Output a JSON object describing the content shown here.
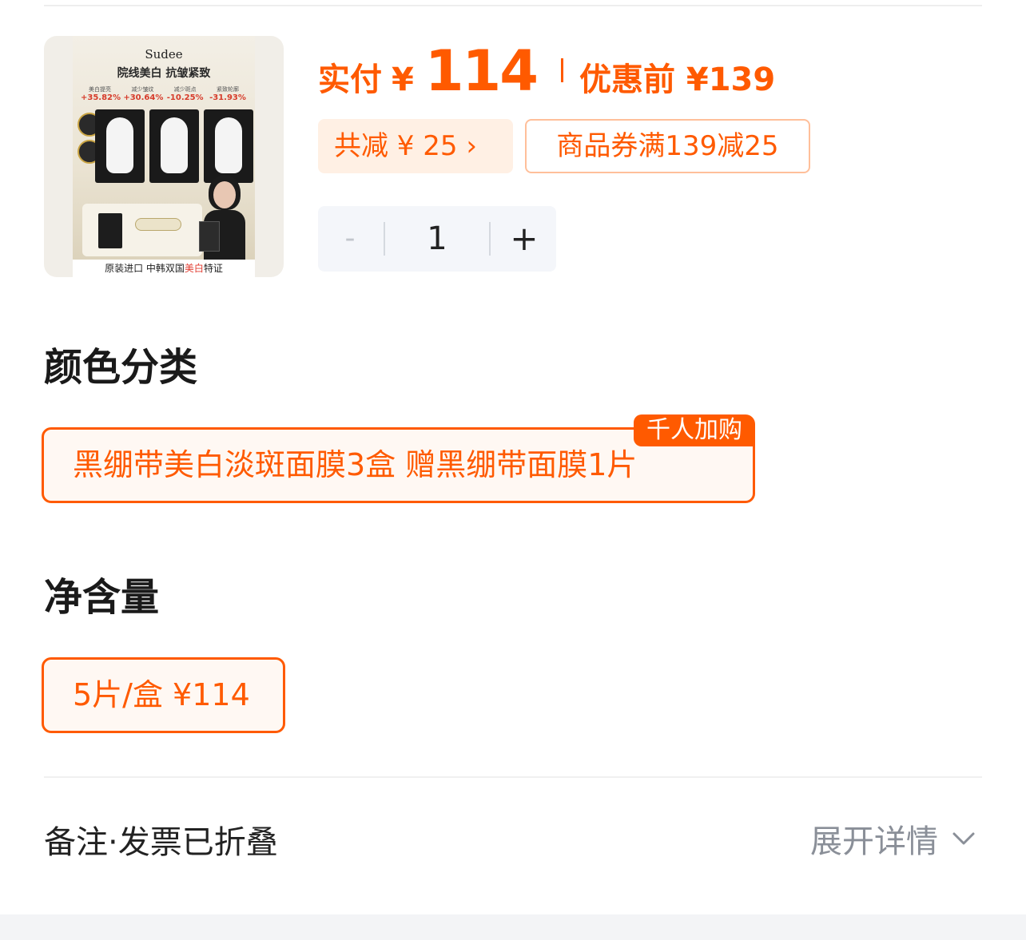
{
  "product": {
    "image": {
      "brand": "Sudee",
      "headline": "院线美白 抗皱紧致",
      "stats": [
        {
          "label": "美白提亮",
          "value": "+35.82%"
        },
        {
          "label": "减少皱纹",
          "value": "+30.64%"
        },
        {
          "label": "减少斑点",
          "value": "-10.25%"
        },
        {
          "label": "紧致轮廓",
          "value": "-31.93%"
        }
      ],
      "footer_prefix": "原装进口 中韩双国",
      "footer_highlight": "美白",
      "footer_suffix": "特证"
    },
    "price": {
      "paid_label": "实付",
      "currency": "¥",
      "amount": "114",
      "original_label": "优惠前 ¥139"
    },
    "discount": {
      "total_label": "共减 ¥ 25 ›",
      "coupon_label": "商品券满139减25"
    },
    "quantity": {
      "minus": "-",
      "value": "1",
      "plus": "+"
    }
  },
  "color_section": {
    "title": "颜色分类",
    "badge": "千人加购",
    "selected_option": "黑绷带美白淡斑面膜3盒 赠黑绷带面膜1片"
  },
  "net_section": {
    "title": "净含量",
    "selected_option": "5片/盒  ¥114"
  },
  "remarks": {
    "label": "备注·发票已折叠",
    "expand_label": "展开详情"
  },
  "colors": {
    "accent": "#ff5a00",
    "accent_light": "#fff0e4",
    "text_primary": "#1a1a1a",
    "text_secondary": "#8a8f98"
  }
}
